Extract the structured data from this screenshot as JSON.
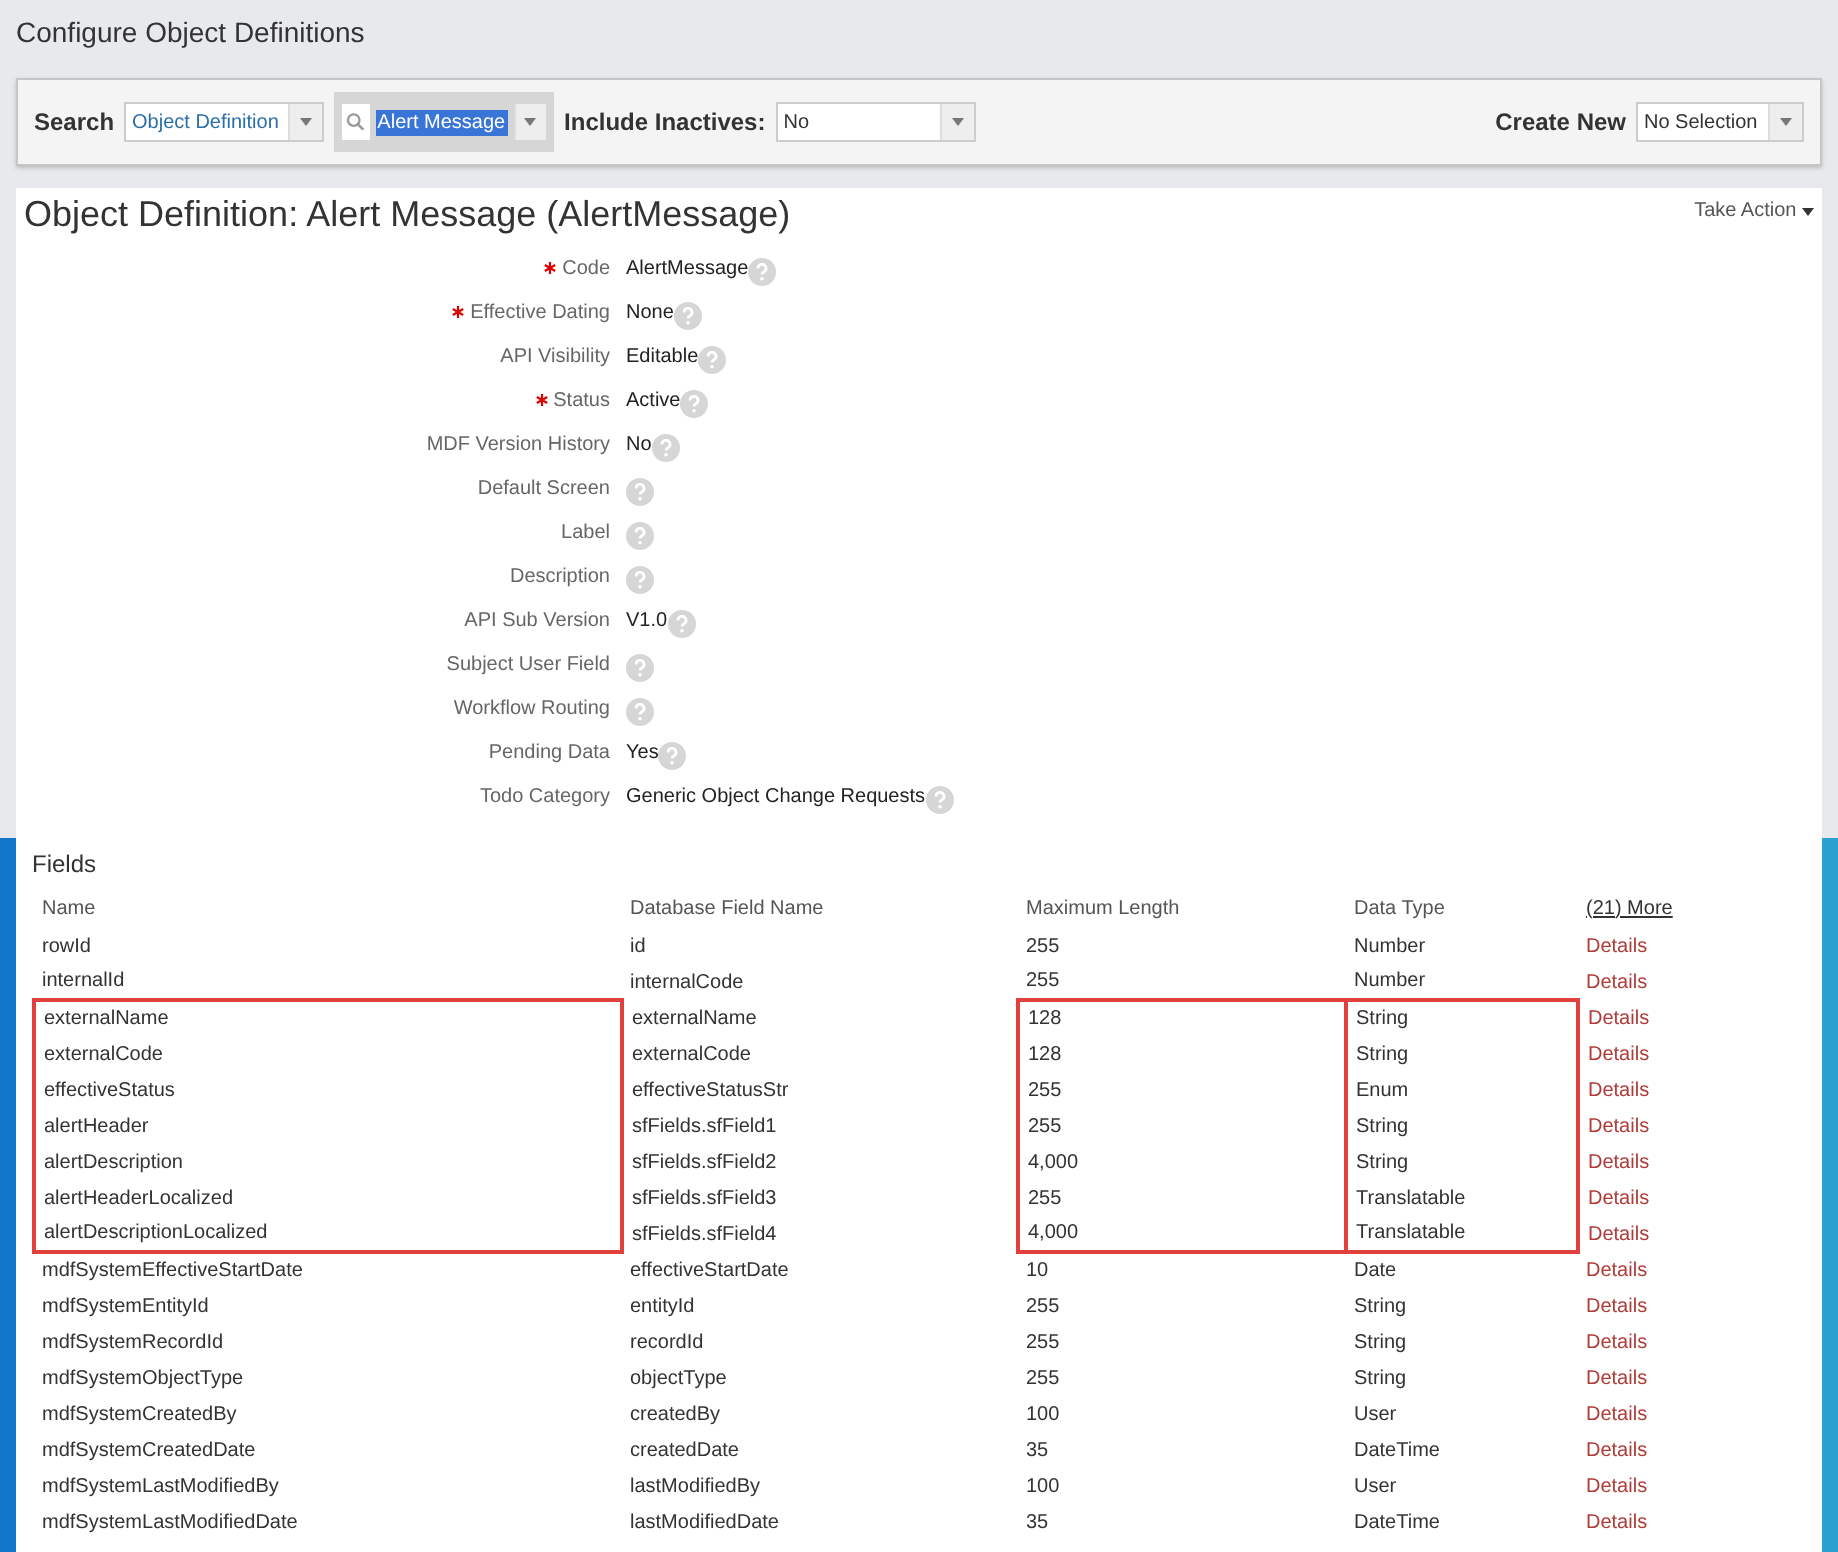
{
  "page_title": "Configure Object Definitions",
  "search_bar": {
    "label": "Search",
    "type_select": "Object Definition",
    "search_value": "Alert Message",
    "inactives_label": "Include Inactives:",
    "inactives_select": "No",
    "create_label": "Create New",
    "create_select": "No Selection"
  },
  "definition": {
    "title": "Object Definition: Alert Message (AlertMessage)",
    "action": "Take Action",
    "properties": [
      {
        "label": "Code",
        "required": true,
        "value": "AlertMessage"
      },
      {
        "label": "Effective Dating",
        "required": true,
        "value": "None"
      },
      {
        "label": "API Visibility",
        "required": false,
        "value": "Editable"
      },
      {
        "label": "Status",
        "required": true,
        "value": "Active"
      },
      {
        "label": "MDF Version History",
        "required": false,
        "value": "No"
      },
      {
        "label": "Default Screen",
        "required": false
      },
      {
        "label": "Label",
        "required": false
      },
      {
        "label": "Description",
        "required": false
      },
      {
        "label": "API Sub Version",
        "required": false,
        "value": "V1.0"
      },
      {
        "label": "Subject User Field",
        "required": false
      },
      {
        "label": "Workflow Routing",
        "required": false
      },
      {
        "label": "Pending Data",
        "required": false,
        "value": "Yes"
      },
      {
        "label": "Todo Category",
        "required": false,
        "value": "Generic Object Change Requests"
      }
    ]
  },
  "fields": {
    "title": "Fields",
    "columns": [
      "Name",
      "Database Field Name",
      "Maximum Length",
      "Data Type"
    ],
    "more": "(21) More",
    "rows": [
      {
        "name": "rowId",
        "db": "id",
        "max": "255",
        "type": "Number",
        "details": "Details",
        "highlighted": false
      },
      {
        "name": "internalId",
        "db": "internalCode",
        "max": "255",
        "type": "Number",
        "details": "Details",
        "highlighted": false
      },
      {
        "name": "externalName",
        "db": "externalName",
        "max": "128",
        "type": "String",
        "details": "Details",
        "highlighted": true
      },
      {
        "name": "externalCode",
        "db": "externalCode",
        "max": "128",
        "type": "String",
        "details": "Details",
        "highlighted": true
      },
      {
        "name": "effectiveStatus",
        "db": "effectiveStatusStr",
        "max": "255",
        "type": "Enum",
        "details": "Details",
        "highlighted": true
      },
      {
        "name": "alertHeader",
        "db": "sfFields.sfField1",
        "max": "255",
        "type": "String",
        "details": "Details",
        "highlighted": true
      },
      {
        "name": "alertDescription",
        "db": "sfFields.sfField2",
        "max": "4,000",
        "type": "String",
        "details": "Details",
        "highlighted": true
      },
      {
        "name": "alertHeaderLocalized",
        "db": "sfFields.sfField3",
        "max": "255",
        "type": "Translatable",
        "details": "Details",
        "highlighted": true
      },
      {
        "name": "alertDescriptionLocalized",
        "db": "sfFields.sfField4",
        "max": "4,000",
        "type": "Translatable",
        "details": "Details",
        "highlighted": true
      },
      {
        "name": "mdfSystemEffectiveStartDate",
        "db": "effectiveStartDate",
        "max": "10",
        "type": "Date",
        "details": "Details",
        "highlighted": false
      },
      {
        "name": "mdfSystemEntityId",
        "db": "entityId",
        "max": "255",
        "type": "String",
        "details": "Details",
        "highlighted": false
      },
      {
        "name": "mdfSystemRecordId",
        "db": "recordId",
        "max": "255",
        "type": "String",
        "details": "Details",
        "highlighted": false
      },
      {
        "name": "mdfSystemObjectType",
        "db": "objectType",
        "max": "255",
        "type": "String",
        "details": "Details",
        "highlighted": false
      },
      {
        "name": "mdfSystemCreatedBy",
        "db": "createdBy",
        "max": "100",
        "type": "User",
        "details": "Details",
        "highlighted": false
      },
      {
        "name": "mdfSystemCreatedDate",
        "db": "createdDate",
        "max": "35",
        "type": "DateTime",
        "details": "Details",
        "highlighted": false
      },
      {
        "name": "mdfSystemLastModifiedBy",
        "db": "lastModifiedBy",
        "max": "100",
        "type": "User",
        "details": "Details",
        "highlighted": false
      },
      {
        "name": "mdfSystemLastModifiedDate",
        "db": "lastModifiedDate",
        "max": "35",
        "type": "DateTime",
        "details": "Details",
        "highlighted": false
      }
    ]
  }
}
